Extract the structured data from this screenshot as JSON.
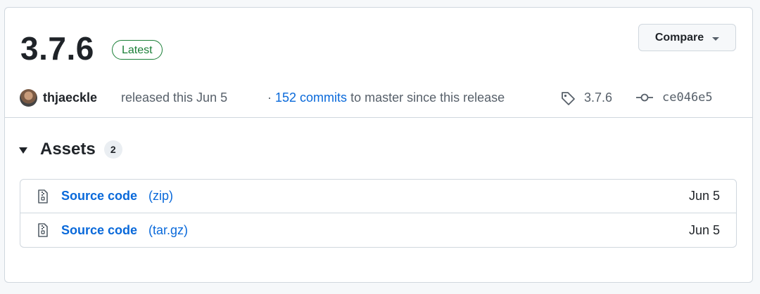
{
  "release": {
    "version": "3.7.6",
    "badge": "Latest",
    "compare_label": "Compare",
    "author": "thjaeckle",
    "released_text": "released this Jun 5",
    "commits_prefix": "·",
    "commits_link": "152 commits",
    "commits_suffix": "to master since this release",
    "tag": "3.7.6",
    "commit_sha": "ce046e5"
  },
  "assets": {
    "title": "Assets",
    "count": "2",
    "items": [
      {
        "name": "Source code",
        "ext": "(zip)",
        "date": "Jun 5"
      },
      {
        "name": "Source code",
        "ext": "(tar.gz)",
        "date": "Jun 5"
      }
    ]
  },
  "colors": {
    "accent_link": "#0969da",
    "badge_green": "#1a7f37",
    "border": "#d0d7de",
    "muted_text": "#57606a"
  },
  "icons": {
    "tag": "tag-icon",
    "commit": "git-commit-icon",
    "file_zip": "file-zip-icon",
    "dropdown": "triangle-down-icon",
    "collapse": "triangle-down-icon"
  }
}
